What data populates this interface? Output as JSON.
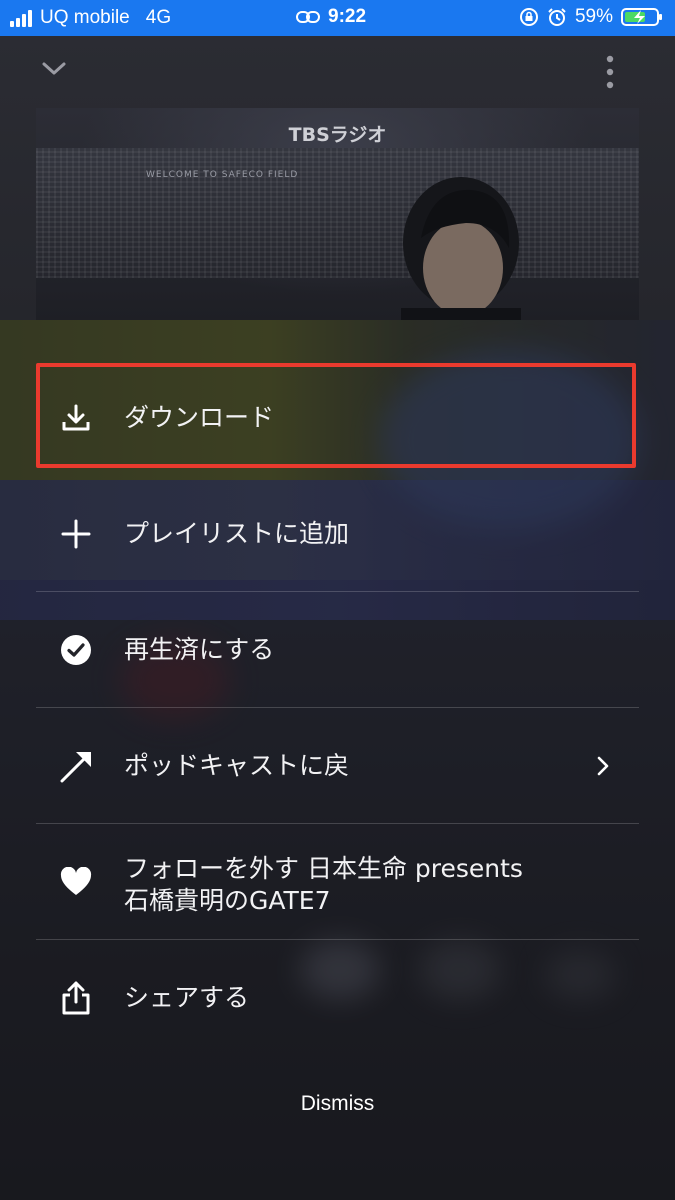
{
  "status_bar": {
    "carrier": "UQ mobile",
    "network": "4G",
    "time": "9:22",
    "battery": "59%",
    "background_color": "#1a78f0"
  },
  "header": {
    "collapse_icon": "chevron-down-icon",
    "more_icon": "vertical-dots-icon"
  },
  "artwork": {
    "title": "TBSラジオ",
    "stadium_sign": "WELCOME TO SAFECO FIELD"
  },
  "menu": {
    "items": [
      {
        "label": "ダウンロード",
        "icon": "download-icon",
        "highlighted": true
      },
      {
        "label": "プレイリストに追加",
        "icon": "plus-icon"
      },
      {
        "label": "再生済にする",
        "icon": "check-circle-icon"
      },
      {
        "label": "ポッドキャストに戻",
        "icon": "arrow-up-right-icon",
        "has_chevron": true
      },
      {
        "label_line1": "フォローを外す 日本生命 presents",
        "label_line2": "石橋貴明のGATE7",
        "icon": "heart-icon"
      },
      {
        "label": "シェアする",
        "icon": "share-icon"
      }
    ]
  },
  "dismiss_label": "Dismiss",
  "colors": {
    "highlight_border": "#ea3a2e",
    "sheet_background": "#23242a"
  }
}
